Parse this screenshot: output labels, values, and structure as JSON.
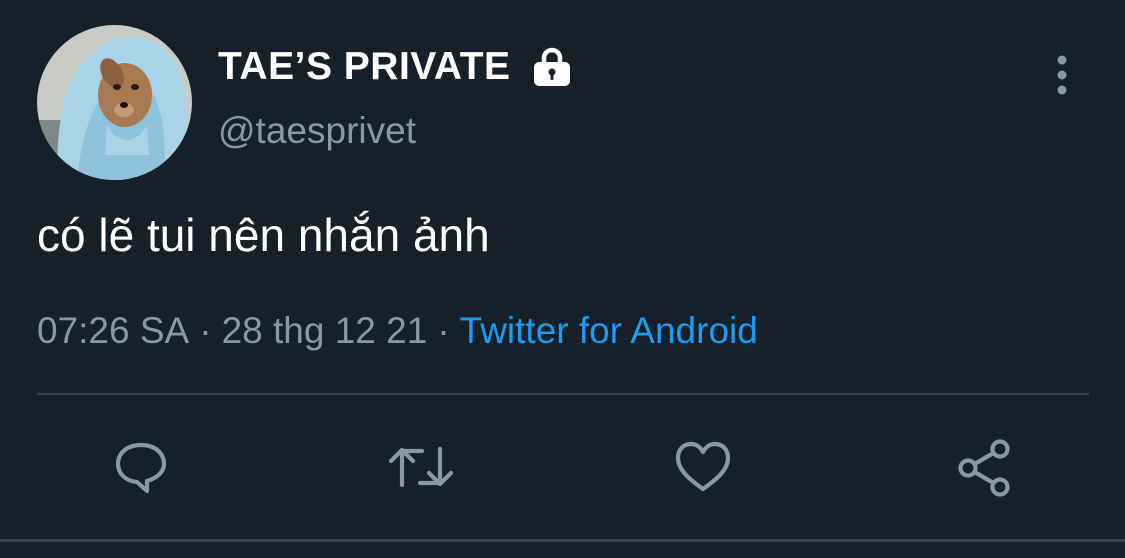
{
  "tweet": {
    "display_name": "TAE’S PRIVATE",
    "handle": "@taesprivet",
    "text": "có lẽ tui nên nhắn ảnh",
    "time": "07:26 SA",
    "separator": "·",
    "date": "28 thg 12 21",
    "source": "Twitter for Android",
    "protected_icon": "lock-icon",
    "avatar": "dog-in-hoodie-avatar"
  },
  "actions": {
    "icons": [
      "reply-icon",
      "retweet-icon",
      "like-icon",
      "share-icon"
    ]
  },
  "colors": {
    "background": "#15202b",
    "primary_text": "#ffffff",
    "secondary_text": "#8899a6",
    "link": "#1d9bf0",
    "divider": "#38444d"
  }
}
